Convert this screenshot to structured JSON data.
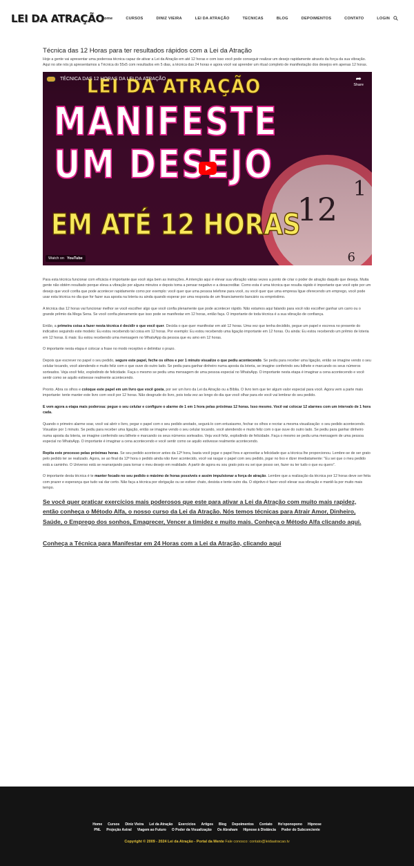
{
  "header": {
    "logo": "LEI DA ATRAÇÃO",
    "nav": [
      "Home",
      "CURSOS",
      "DINIZ VIEIRA",
      "LEI DA ATRAÇÃO",
      "TECNICAS",
      "BLOG",
      "DEPOIMENTOS",
      "CONTATO",
      "LOGIN"
    ],
    "search_icon": "search-icon"
  },
  "main": {
    "title": "Técnica das 12 Horas para ter resultados rápidos com a Lei da Atração",
    "intro": "Hoje a gente vai apresentar uma poderosa técnica capaz de ativar a Lei da Atração em até 12 horas e com isso você pode conseguir realizar um desejo rapidamente através da força da sua vibração. Aqui no site nós já apresentamos a Técnica do 55x5 com resultados em 5 dias, a técnica das 24 horas e agora você vai aprender um ritual completo de manifestação dos desejos em apenas 12 horas.",
    "video": {
      "title": "TÉCNICA DAS 12 HORAS DA LEI DA ATRAÇÃO",
      "share": "Share",
      "thumb_line1": "LEI DA ATRAÇÃO",
      "thumb_line2": "MANIFESTE",
      "thumb_line3": "UM DESEJO",
      "thumb_line4": "EM ATÉ 12 HORAS",
      "clock_12": "12",
      "clock_1": "1",
      "clock_6": "6",
      "watch_on": "Watch on",
      "youtube": "YouTube"
    },
    "paragraphs": [
      {
        "pre": "Para esta técnica funcionar com eficácia é importante que você siga bem as instruções. A intenção aqui é elevar sua vibração várias vezes a ponto de criar o poder de atração daquilo que deseja. Muita gente não obtém resultado porque eleva a vibração por alguns minutos e depois toma a pensar negativo e a desacreditar. Como esta é uma técnica que resulta rápido é importante que você opte por um desejo que você confia que pode acontecer rapidamente como por exemplo: você quer que uma pessoa telefone para você, ou você quer que uma empresa ligue oferecendo um emprego, você pode usar esta técnica no dia que for fazer sua aposta na loteria ou ainda quando esperar por uma resposta de um financiamento bancário ou empréstimo.",
        "bold": "",
        "post": ""
      },
      {
        "pre": "A técnica das 12 horas vai funcionar melhor se você escolher algo que você confia plenamente que pode acontecer rápido. Não estamos aqui falando para você não escolher ganhar um carro ou o grande prêmio da Mega Sena. Se você confia plenamente que isso pode se manifestar em 12 horas, então faça. O importante de toda técnica é a sua vibração de confiança.",
        "bold": "",
        "post": ""
      },
      {
        "pre": "Então, a ",
        "bold": "primeira coisa a fazer nesta técnica é decidir o que você quer",
        "post": ". Decida o que quer manifestar em até 12 horas. Uma vez que tenha decidido, pegue um papel e escreva no presente do indicativo seguindo este modelo: Eu estou recebendo tal coisa em 12 horas. Por exemplo: Eu estou recebendo uma ligação importante em 12 horas. Ou ainda: Eu estou recebendo um prêmio de loteria em 12 horas. E mais: Eu estou recebendo uma mensagem no WhatsApp da pessoa que eu amo em 12 horas."
      },
      {
        "pre": "O importante nesta etapa é colocar a frase no modo receptivo e delimitar o prazo.",
        "bold": "",
        "post": ""
      },
      {
        "pre": "Depois que escrever no papel o seu pedido, ",
        "bold": "segure este papel, feche os olhos e por 1 minuto visualize o que pediu acontecendo",
        "post": ". Se pediu para receber uma ligação, então se imagine vendo o seu celular tocando, você atendendo e muito feliz com o que ouve do outro lado. Se pediu para ganhar dinheiro numa aposta da loteria, se imagine conferindo seu bilhete e marcando os seus números sorteados. Veja você feliz, explodindo de felicidade. Faça o mesmo se pediu uma mensagem de uma pessoa especial no WhatsApp. O importante nesta etapa é imaginar a cena acontecendo e você sentir como se aquilo estivesse realmente acontecendo."
      },
      {
        "pre": "Pronto. Abra os olhos e ",
        "bold": "coloque este papel em um livro que você gosta",
        "post": ", por ser um livro da Lei da Atração ou a Bíblia. O livro tem que ter algum valor especial para você. Agora vem a parte mais importante: tente manter este livro com você por 12 horas. Não desgrude do livro, pois toda vez ao longo do dia que você olhar para ele você vai lembrar do seu pedido."
      },
      {
        "pre": "",
        "bold": "E vem agora a etapa mais poderosa: pegue o seu celular e configure o alarme de 1 em 1 hora pelas próximas 12 horas. Isso mesmo. Você vai colocar 12 alarmes com um intervalo de 1 hora cada.",
        "post": ""
      },
      {
        "pre": "Quando o primeiro alarme soar, você vai abrir o livro, pegar o papel com o seu pedido anotado, segurá-lo com entusiasmo, fechar os olhos e recriar a mesma visualização: o seu pedido acontecendo. Visualize por 1 minuto. Se pediu para receber uma ligação, então se imagine vendo o seu celular tocando, você atendendo e muito feliz com o que ouve do outro lado. Se pediu para ganhar dinheiro numa aposta da loteria, se imagine conferindo seu bilhete e marcando os seus números sorteados. Veja você feliz, explodindo de felicidade. Faça o mesmo se pediu uma mensagem de uma pessoa especial no WhatsApp. O importante é imaginar a cena acontecendo e você sentir como se aquilo estivesse realmente acontecendo.",
        "bold": "",
        "post": ""
      },
      {
        "pre": "",
        "bold": "Repita este processo pelas próximas horas",
        "post": ". Se seu pedido acontecer antes da 12ª hora, basta você jogar o papel fora e aproveitar a felicidade que a técnica lhe proporcionou. Lembre-se de ser grato pelo pedido ter se realizado. Agora, se ao final da 12ª hora o pedido ainda não tiver acontecido, você vai rasgar o papel com seu pedido, jogar no lixo e dizer imediatamente: \"Eu sei que o meu pedido está a caminho. O Universo está se rearranjando para tornar o meu desejo em realidade. A partir de agora eu sou grato pois eu sei que posso ser, fazer ou ter tudo o que eu quero\"."
      },
      {
        "pre": "O importante desta técnica é te ",
        "bold": "manter focado no seu pedido o máximo de horas possíveis e assim impulsionar a força de atração",
        "post": ". Lembre que a realização da técnica por 12 horas deve ser feita com prazer e esperança que tudo vai dar certo. Não faça a técnica por obrigação ou se estiver chato, desista e tente outro dia. O objetivo é fazer você elevar sua vibração e mantê-la por muito mais tempo."
      }
    ],
    "cta1": "Se você quer praticar exercícios mais poderosos que este para ativar a Lei da Atração com muito mais rapidez, então conheça o Método Alfa, o nosso curso da Lei da Atração. Nós temos técnicas para Atrair Amor, Dinheiro, Saúde, o Emprego dos sonhos, Emagrecer, Vencer a timidez e muito mais. Conheça o Método Alfa clicando aqui.",
    "cta2": "Conheça a Técnica para Manifestar em 24 Horas com a Lei da Atração, clicando aqui"
  },
  "footer": {
    "links_row1": [
      "Home",
      "Cursos",
      "Diniz Vieira",
      "Lei da Atração",
      "Exercícios",
      "Artigos",
      "Blog",
      "Depoimentos",
      "Contato",
      "Ho'oponopono",
      "Hipnose"
    ],
    "links_row2": [
      "PNL",
      "Projeção Astral",
      "Viagem ao Futuro",
      "O Poder da Visualização",
      "Os Abraham",
      "Hipnose à Distância",
      "Poder do Subconciente"
    ],
    "copyright": "Copyright © 2009 - 2024 Lei da Atração - Portal da Mente",
    "contact": "Fale conosco: contato@leidaatracao.tv"
  },
  "colors": {
    "footer_bg": "#141414",
    "copyright": "#e6c43a",
    "video_accent": "#e0218a",
    "play_red": "#ff0000"
  }
}
